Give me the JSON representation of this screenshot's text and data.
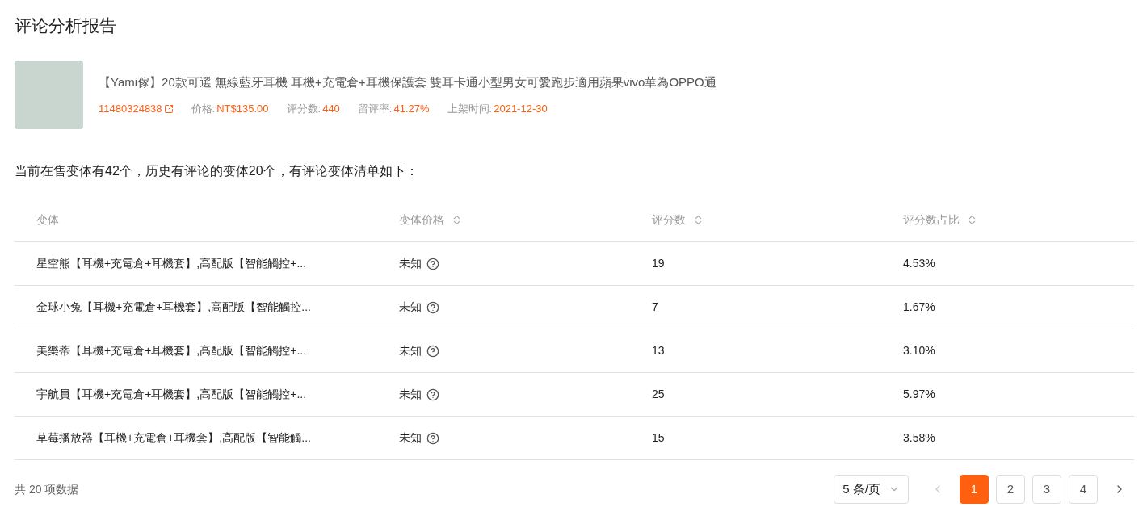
{
  "page_title": "评论分析报告",
  "product": {
    "title": "【Yami傢】20款可選 無線藍牙耳機 耳機+充電倉+耳機保護套 雙耳卡通小型男女可愛跑步適用蘋果vivo華為OPPO通",
    "id": "11480324838",
    "meta": [
      {
        "label": "价格:",
        "value": "NT$135.00"
      },
      {
        "label": "评分数:",
        "value": "440"
      },
      {
        "label": "留评率:",
        "value": "41.27%"
      },
      {
        "label": "上架时间:",
        "value": "2021-12-30"
      }
    ]
  },
  "summary": "当前在售变体有42个，历史有评论的变体20个，有评论变体清单如下：",
  "table": {
    "columns": [
      {
        "label": "变体",
        "sortable": false
      },
      {
        "label": "变体价格",
        "sortable": true
      },
      {
        "label": "评分数",
        "sortable": true
      },
      {
        "label": "评分数占比",
        "sortable": true
      }
    ],
    "rows": [
      {
        "variant": "星空熊【耳機+充電倉+耳機套】,高配版【智能觸控+...",
        "price": "未知",
        "ratings": "19",
        "share": "4.53%"
      },
      {
        "variant": "金球小兔【耳機+充電倉+耳機套】,高配版【智能觸控...",
        "price": "未知",
        "ratings": "7",
        "share": "1.67%"
      },
      {
        "variant": "美樂蒂【耳機+充電倉+耳機套】,高配版【智能觸控+...",
        "price": "未知",
        "ratings": "13",
        "share": "3.10%"
      },
      {
        "variant": "宇航員【耳機+充電倉+耳機套】,高配版【智能觸控+...",
        "price": "未知",
        "ratings": "25",
        "share": "5.97%"
      },
      {
        "variant": "草莓播放器【耳機+充電倉+耳機套】,高配版【智能觸...",
        "price": "未知",
        "ratings": "15",
        "share": "3.58%"
      }
    ]
  },
  "pagination": {
    "total": "共 20 项数据",
    "page_size": "5 条/页",
    "prev_disabled": true,
    "next_disabled": false,
    "pages": [
      {
        "label": "1",
        "selected": true
      },
      {
        "label": "2",
        "selected": false
      },
      {
        "label": "3",
        "selected": false
      },
      {
        "label": "4",
        "selected": false
      }
    ]
  }
}
